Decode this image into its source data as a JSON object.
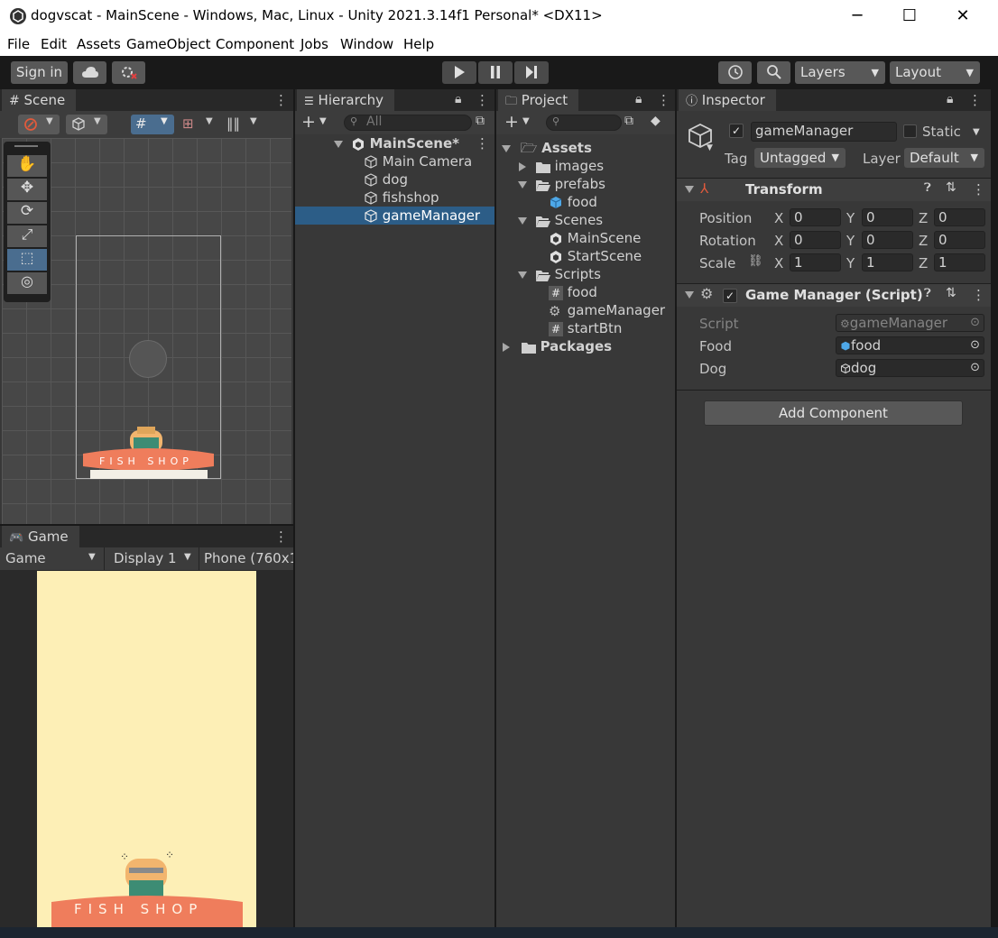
{
  "window": {
    "title": "dogvscat - MainScene - Windows, Mac, Linux - Unity 2021.3.14f1 Personal* <DX11>",
    "minimize": "─",
    "maximize": "☐",
    "close": "✕"
  },
  "menu": [
    "File",
    "Edit",
    "Assets",
    "GameObject",
    "Component",
    "Jobs",
    "Window",
    "Help"
  ],
  "toolbar": {
    "sign_in": "Sign in",
    "layers": "Layers",
    "layout": "Layout"
  },
  "scene": {
    "tab": "Scene"
  },
  "game": {
    "tab": "Game",
    "mode": "Game",
    "display": "Display 1",
    "resolution": "Phone (760x1",
    "shop_sign": "FISH SHOP",
    "background": "#fdefb6"
  },
  "hierarchy": {
    "tab": "Hierarchy",
    "search_placeholder": "All",
    "scene": "MainScene*",
    "items": [
      "Main Camera",
      "dog",
      "fishshop",
      "gameManager"
    ]
  },
  "project": {
    "tab": "Project",
    "assets": "Assets",
    "images": "images",
    "prefabs": "prefabs",
    "prefab_food": "food",
    "scenes": "Scenes",
    "scene_main": "MainScene",
    "scene_start": "StartScene",
    "scripts": "Scripts",
    "script_food": "food",
    "script_gm": "gameManager",
    "script_start": "startBtn",
    "packages": "Packages"
  },
  "inspector": {
    "tab": "Inspector",
    "object_name": "gameManager",
    "static_label": "Static",
    "tag_label": "Tag",
    "tag_value": "Untagged",
    "layer_label": "Layer",
    "layer_value": "Default",
    "transform": {
      "title": "Transform",
      "position_label": "Position",
      "rotation_label": "Rotation",
      "scale_label": "Scale",
      "x": "X",
      "y": "Y",
      "z": "Z",
      "position": [
        "0",
        "0",
        "0"
      ],
      "rotation": [
        "0",
        "0",
        "0"
      ],
      "scale": [
        "1",
        "1",
        "1"
      ]
    },
    "script_component": {
      "title": "Game Manager (Script)",
      "script_label": "Script",
      "script_value": "gameManager",
      "food_label": "Food",
      "food_value": "food",
      "dog_label": "Dog",
      "dog_value": "dog"
    },
    "add_component": "Add Component"
  },
  "colors": {
    "selection": "#2c5d87",
    "panel": "#383838",
    "accent_blue": "#4ea8e8"
  }
}
